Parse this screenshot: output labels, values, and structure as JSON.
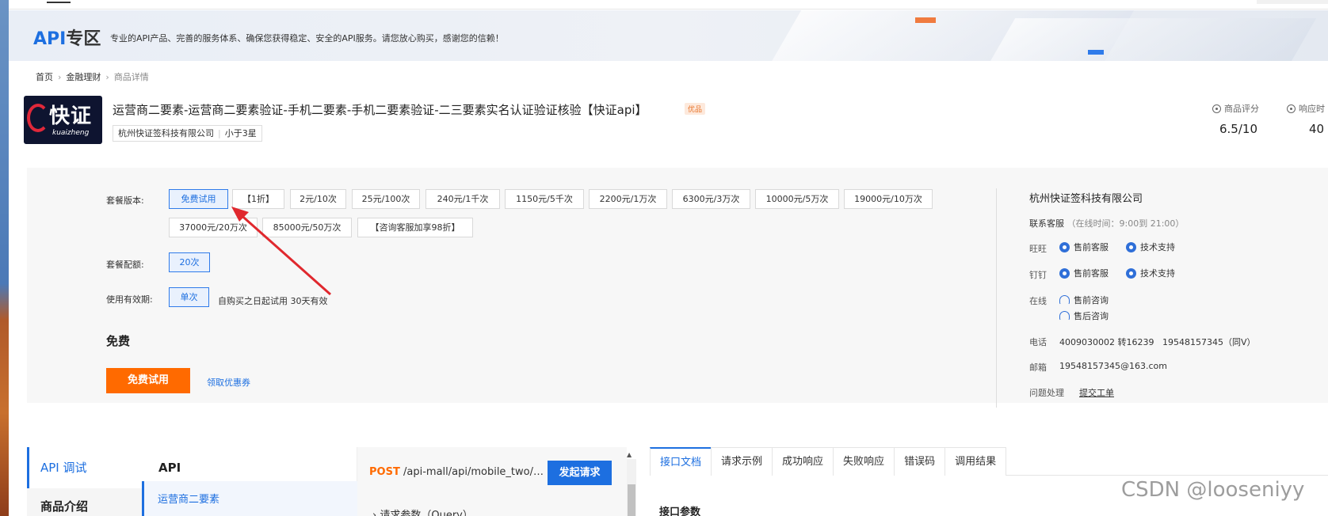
{
  "banner": {
    "title_api": "API",
    "title_zone": "专区",
    "desc": "专业的API产品、完善的服务体系、确保您获得稳定、安全的API服务。请您放心购买，感谢您的信赖！"
  },
  "breadcrumb": [
    "首页",
    "金融理财",
    "商品详情"
  ],
  "product": {
    "logo_text": "快证",
    "logo_sub": "kuaizheng",
    "title": "运营商二要素-运营商二要素验证-手机二要素-手机二要素验证-二三要素实名认证验证核验【快证api】",
    "tag": "优品",
    "company": "杭州快证签科技有限公司",
    "stars": "小于3星",
    "rating_label": "商品评分",
    "rating_value": "6.5/10",
    "response_label": "响应时",
    "response_value": "40"
  },
  "package": {
    "version_label": "套餐版本:",
    "versions": [
      "免费试用",
      "【1折】",
      "2元/10次",
      "25元/100次",
      "240元/1千次",
      "1150元/5千次",
      "2200元/1万次",
      "6300元/3万次",
      "10000元/5万次",
      "19000元/10万次",
      "37000元/20万次",
      "85000元/50万次",
      "【咨询客服加享98折】"
    ],
    "quota_label": "套餐配额:",
    "quota_value": "20次",
    "validity_label": "使用有效期:",
    "validity_value": "单次",
    "validity_note": "自购买之日起试用 30天有效",
    "price": "免费",
    "trial_button": "免费试用",
    "coupon_link": "领取优惠券"
  },
  "side": {
    "company": "杭州快证签科技有限公司",
    "contact_label": "联系客服",
    "contact_hours": "（在线时间：9:00到 21:00）",
    "wangwang_label": "旺旺",
    "dingding_label": "钉钉",
    "presale": "售前客服",
    "tech": "技术支持",
    "online_label": "在线",
    "presale_consult": "售前咨询",
    "aftersale_consult": "售后咨询",
    "phone_label": "电话",
    "phone_value": "4009030002 转16239",
    "phone_alt": "19548157345（同V）",
    "email_label": "邮箱",
    "email_value": "19548157345@163.com",
    "issue_label": "问题处理",
    "issue_link": "提交工单"
  },
  "bottom": {
    "nav_debug": "API 调试",
    "nav_intro": "商品介绍",
    "api_head": "API",
    "api_item": "运营商二要素",
    "method": "POST",
    "url": "/api-mall/api/mobile_two/check",
    "send": "发起请求",
    "query": "请求参数（Query）",
    "tabs": [
      "接口文档",
      "请求示例",
      "成功响应",
      "失败响应",
      "错误码",
      "调用结果"
    ],
    "doc_head": "接口参数"
  },
  "watermark": "CSDN @looseniyy",
  "colors": {
    "accent": "#1d6fe0",
    "orange": "#ff6a00",
    "arrow": "#e0282e"
  }
}
